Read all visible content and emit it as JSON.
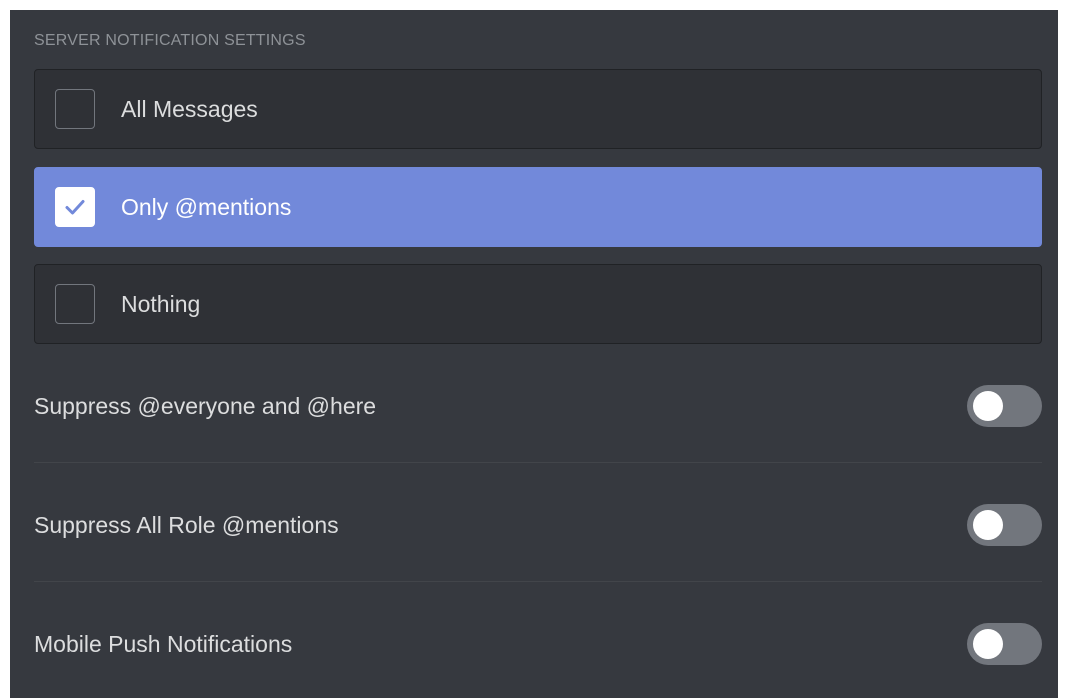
{
  "section": {
    "header": "SERVER NOTIFICATION SETTINGS"
  },
  "options": [
    {
      "label": "All Messages",
      "selected": false
    },
    {
      "label": "Only @mentions",
      "selected": true
    },
    {
      "label": "Nothing",
      "selected": false
    }
  ],
  "toggles": [
    {
      "label": "Suppress @everyone and @here",
      "enabled": false
    },
    {
      "label": "Suppress All Role @mentions",
      "enabled": false
    },
    {
      "label": "Mobile Push Notifications",
      "enabled": false
    }
  ],
  "colors": {
    "panel_bg": "#36393f",
    "option_bg": "#2f3136",
    "selected_bg": "#7289da",
    "toggle_off": "#72767d",
    "text": "#dcddde"
  }
}
